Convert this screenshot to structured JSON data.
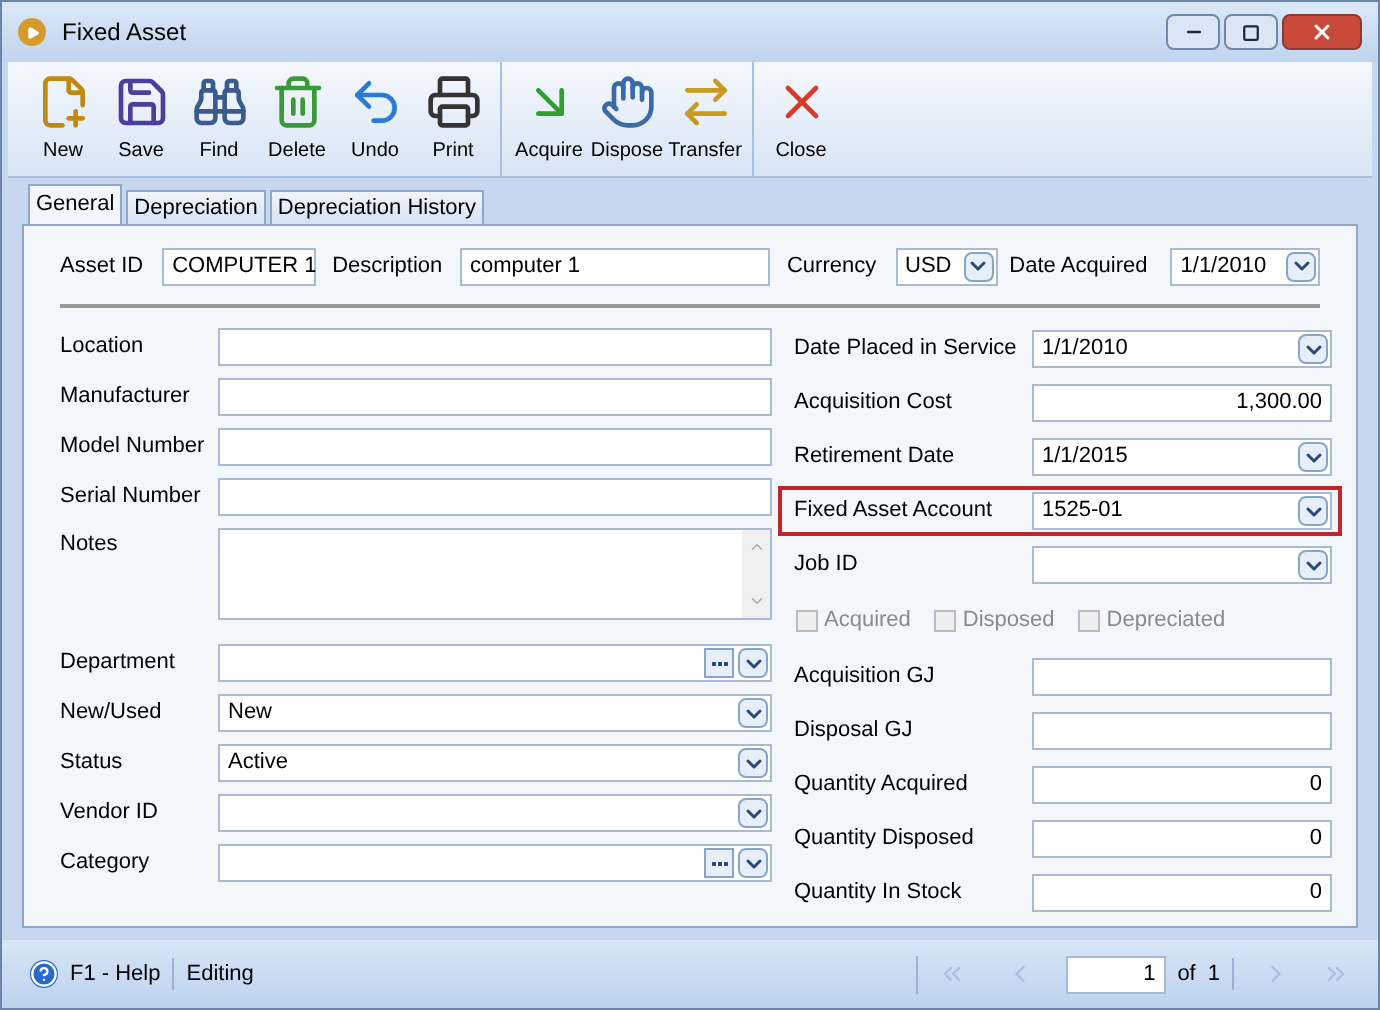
{
  "window": {
    "title": "Fixed Asset"
  },
  "toolbar": [
    [
      {
        "label": "New"
      },
      {
        "label": "Save"
      },
      {
        "label": "Find"
      },
      {
        "label": "Delete"
      },
      {
        "label": "Undo"
      },
      {
        "label": "Print"
      }
    ],
    [
      {
        "label": "Acquire"
      },
      {
        "label": "Dispose"
      },
      {
        "label": "Transfer"
      }
    ],
    [
      {
        "label": "Close"
      }
    ]
  ],
  "tabs": [
    {
      "label": "General",
      "selected": true
    },
    {
      "label": "Depreciation",
      "selected": false
    },
    {
      "label": "Depreciation History",
      "selected": false
    }
  ],
  "header": {
    "asset_id": {
      "label": "Asset ID",
      "value": "COMPUTER 1"
    },
    "description": {
      "label": "Description",
      "value": "computer 1"
    },
    "currency": {
      "label": "Currency",
      "value": "USD"
    },
    "date_acquired": {
      "label": "Date Acquired",
      "value": "1/1/2010"
    }
  },
  "left_fields": [
    {
      "kind": "text",
      "label": "Location"
    },
    {
      "kind": "text",
      "label": "Manufacturer"
    },
    {
      "kind": "text",
      "label": "Model Number"
    },
    {
      "kind": "text",
      "label": "Serial Number"
    },
    {
      "kind": "textarea",
      "label": "Notes"
    },
    {
      "kind": "lookup",
      "label": "Department"
    },
    {
      "kind": "combo",
      "label": "New/Used",
      "value": "New"
    },
    {
      "kind": "combo",
      "label": "Status",
      "value": "Active"
    },
    {
      "kind": "combo",
      "label": "Vendor ID"
    },
    {
      "kind": "lookup",
      "label": "Category"
    }
  ],
  "right_fields": [
    {
      "kind": "combo",
      "label": "Date Placed in Service",
      "value": "1/1/2010",
      "highlighted": false
    },
    {
      "kind": "number",
      "label": "Acquisition Cost",
      "value": "1,300.00",
      "highlighted": false
    },
    {
      "kind": "combo",
      "label": "Retirement Date",
      "value": "1/1/2015",
      "highlighted": false
    },
    {
      "kind": "combo",
      "label": "Fixed Asset Account",
      "value": "1525-01",
      "highlighted": true
    },
    {
      "kind": "combo",
      "label": "Job ID",
      "highlighted": false
    },
    {
      "kind": "checks",
      "checks": [
        {
          "label": "Acquired",
          "checked": false,
          "disabled": true
        },
        {
          "label": "Disposed",
          "checked": false,
          "disabled": true
        },
        {
          "label": "Depreciated",
          "checked": false,
          "disabled": true
        }
      ]
    },
    {
      "kind": "text",
      "label": "Acquisition GJ",
      "highlighted": false
    },
    {
      "kind": "text",
      "label": "Disposal GJ",
      "highlighted": false
    },
    {
      "kind": "number",
      "label": "Quantity Acquired",
      "value": "0",
      "highlighted": false
    },
    {
      "kind": "number",
      "label": "Quantity Disposed",
      "value": "0",
      "highlighted": false
    },
    {
      "kind": "number",
      "label": "Quantity In Stock",
      "value": "0",
      "highlighted": false
    }
  ],
  "status_bar": {
    "help": "F1 - Help",
    "state": "Editing",
    "page": "1",
    "of": "of",
    "total": "1"
  }
}
